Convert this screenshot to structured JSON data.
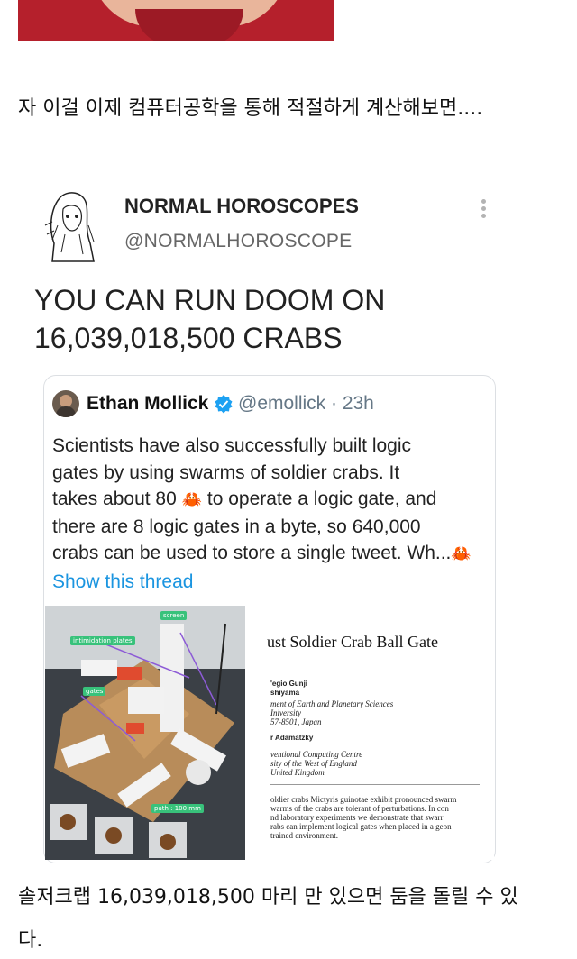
{
  "post": {
    "line1": "자 이걸 이제 컴퓨터공학을 통해 적절하게 계산해보면....",
    "line2a": "솔저크랩 16,039,018,500 마리 만 있으면 둠을 돌릴 수 있",
    "line2b": "다."
  },
  "tweet": {
    "author_name": "NORMAL HOROSCOPES",
    "author_handle": "@NORMALHOROSCOPE",
    "text_line1": "YOU CAN RUN DOOM ON",
    "text_line2": "16,039,018,500 CRABS",
    "more_icon": "more-vertical-icon"
  },
  "quoted_tweet": {
    "name": "Ethan Mollick",
    "verified_icon": "verified-badge-icon",
    "handle_time": "@emollick · 23h",
    "lines": [
      "Scientists have also successfully built logic",
      "gates by using swarms of soldier crabs. It",
      "takes about 80",
      "to operate a logic gate, and",
      "there are 8 logic gates in a byte, so 640,000",
      "crabs can be used to store a single tweet. Wh..."
    ],
    "crab_emoji": "🦀",
    "show_thread": "Show this thread"
  },
  "media": {
    "photo_labels": {
      "screen": "screen",
      "intimidation": "intimidation plates",
      "gates": "gates",
      "path": "path : 100 mm"
    },
    "paper": {
      "title": "ust Soldier Crab Ball Gate",
      "lines": [
        "'egio Gunji",
        "shiyama",
        "ment of Earth and Planetary Sciences",
        "Iniversity",
        "57-8501, Japan",
        "r Adamatzky",
        "ventional Computing Centre",
        "sity of the West of England",
        "United Kingdom",
        "oldier crabs Mictyris guinotae exhibit pronounced swarm",
        "warms of the crabs are tolerant of perturbations. In con",
        "nd laboratory experiments we demonstrate that swarr",
        "rabs can implement logical gates when placed in a geon",
        "trained environment."
      ]
    }
  },
  "colors": {
    "link": "#1b95e0",
    "verified": "#1da1f2",
    "crab": "#d6202a",
    "tag_green": "#38c27b"
  }
}
